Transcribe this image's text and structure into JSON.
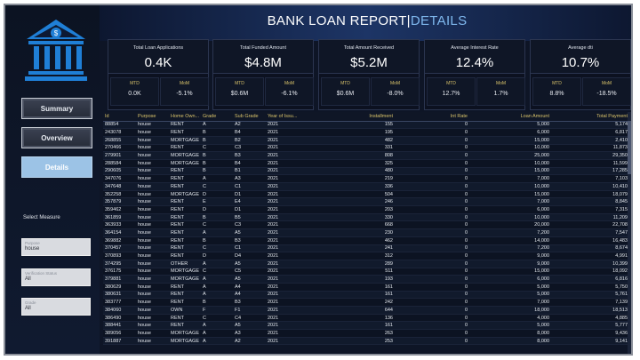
{
  "header": {
    "title_main": "BANK LOAN REPORT",
    "title_sep": "|",
    "title_sub": "DETAILS"
  },
  "sidebar": {
    "nav": [
      {
        "label": "Summary",
        "active": false
      },
      {
        "label": "Overview",
        "active": false
      },
      {
        "label": "Details",
        "active": true
      }
    ],
    "select_measure_label": "Select Measure",
    "slicers": [
      {
        "title": "Purpose",
        "value": "house"
      },
      {
        "title": "Verification Status",
        "value": "All"
      },
      {
        "title": "Grade",
        "value": "All"
      }
    ]
  },
  "kpis": [
    {
      "label": "Total Loan Applications",
      "value": "0.4K",
      "mtd_label": "MTD",
      "mtd": "0.0K",
      "mom_label": "MoM",
      "mom": "-5.1%"
    },
    {
      "label": "Total Funded Amount",
      "value": "$4.8M",
      "mtd_label": "MTD",
      "mtd": "$0.6M",
      "mom_label": "MoM",
      "mom": "-6.1%"
    },
    {
      "label": "Total Amount Received",
      "value": "$5.2M",
      "mtd_label": "MTD",
      "mtd": "$0.6M",
      "mom_label": "MoM",
      "mom": "-8.0%"
    },
    {
      "label": "Average Interest Rate",
      "value": "12.4%",
      "mtd_label": "MTD",
      "mtd": "12.7%",
      "mom_label": "MoM",
      "mom": "1.7%"
    },
    {
      "label": "Average dti",
      "value": "10.7%",
      "mtd_label": "MTD",
      "mtd": "8.8%",
      "mom_label": "MoM",
      "mom": "-18.5%"
    }
  ],
  "table": {
    "columns": [
      "Id",
      "Purpose",
      "Home Own...",
      "Grade",
      "Sub Grade",
      "Year of Issu...",
      "Installment",
      "Int Rate",
      "Loan Amount",
      "Total Payment"
    ],
    "rows": [
      [
        "88854",
        "house",
        "RENT",
        "A",
        "A2",
        "2021",
        "155",
        "0",
        "5,000",
        "5,174"
      ],
      [
        "243078",
        "house",
        "RENT",
        "B",
        "B4",
        "2021",
        "195",
        "0",
        "6,000",
        "6,817"
      ],
      [
        "268855",
        "house",
        "MORTGAGE",
        "B",
        "B2",
        "2021",
        "482",
        "0",
        "15,000",
        "2,410"
      ],
      [
        "270466",
        "house",
        "RENT",
        "C",
        "C3",
        "2021",
        "331",
        "0",
        "10,000",
        "11,873"
      ],
      [
        "279901",
        "house",
        "MORTGAGE",
        "B",
        "B3",
        "2021",
        "808",
        "0",
        "25,000",
        "29,350"
      ],
      [
        "288584",
        "house",
        "MORTGAGE",
        "B",
        "B4",
        "2021",
        "325",
        "0",
        "10,000",
        "11,599"
      ],
      [
        "290605",
        "house",
        "RENT",
        "B",
        "B1",
        "2021",
        "480",
        "0",
        "15,000",
        "17,285"
      ],
      [
        "347076",
        "house",
        "RENT",
        "A",
        "A3",
        "2021",
        "219",
        "0",
        "7,000",
        "7,103"
      ],
      [
        "347648",
        "house",
        "RENT",
        "C",
        "C1",
        "2021",
        "336",
        "0",
        "10,000",
        "10,410"
      ],
      [
        "352258",
        "house",
        "MORTGAGE",
        "D",
        "D1",
        "2021",
        "504",
        "0",
        "15,000",
        "18,079"
      ],
      [
        "357879",
        "house",
        "RENT",
        "E",
        "E4",
        "2021",
        "246",
        "0",
        "7,000",
        "8,845"
      ],
      [
        "359462",
        "house",
        "RENT",
        "D",
        "D1",
        "2021",
        "203",
        "0",
        "6,000",
        "7,315"
      ],
      [
        "361859",
        "house",
        "RENT",
        "B",
        "B5",
        "2021",
        "330",
        "0",
        "10,000",
        "11,209"
      ],
      [
        "363933",
        "house",
        "RENT",
        "C",
        "C3",
        "2021",
        "668",
        "0",
        "20,000",
        "22,708"
      ],
      [
        "364154",
        "house",
        "RENT",
        "A",
        "A5",
        "2021",
        "230",
        "0",
        "7,200",
        "7,547"
      ],
      [
        "369882",
        "house",
        "RENT",
        "B",
        "B3",
        "2021",
        "462",
        "0",
        "14,000",
        "16,483"
      ],
      [
        "370457",
        "house",
        "RENT",
        "C",
        "C1",
        "2021",
        "241",
        "0",
        "7,200",
        "8,674"
      ],
      [
        "370893",
        "house",
        "RENT",
        "D",
        "D4",
        "2021",
        "312",
        "0",
        "9,000",
        "4,991"
      ],
      [
        "374295",
        "house",
        "OTHER",
        "A",
        "A5",
        "2021",
        "289",
        "0",
        "9,000",
        "10,399"
      ],
      [
        "376175",
        "house",
        "MORTGAGE",
        "C",
        "C5",
        "2021",
        "511",
        "0",
        "15,000",
        "18,092"
      ],
      [
        "379881",
        "house",
        "MORTGAGE",
        "A",
        "A5",
        "2021",
        "193",
        "0",
        "6,000",
        "6,816"
      ],
      [
        "380629",
        "house",
        "RENT",
        "A",
        "A4",
        "2021",
        "161",
        "0",
        "5,000",
        "5,750"
      ],
      [
        "380631",
        "house",
        "RENT",
        "A",
        "A4",
        "2021",
        "161",
        "0",
        "5,000",
        "5,761"
      ],
      [
        "383777",
        "house",
        "RENT",
        "B",
        "B3",
        "2021",
        "242",
        "0",
        "7,000",
        "7,139"
      ],
      [
        "384060",
        "house",
        "OWN",
        "F",
        "F1",
        "2021",
        "644",
        "0",
        "18,000",
        "18,513"
      ],
      [
        "386490",
        "house",
        "RENT",
        "C",
        "C4",
        "2021",
        "136",
        "0",
        "4,000",
        "4,885"
      ],
      [
        "388441",
        "house",
        "RENT",
        "A",
        "A5",
        "2021",
        "161",
        "0",
        "5,000",
        "5,777"
      ],
      [
        "389056",
        "house",
        "MORTGAGE",
        "A",
        "A3",
        "2021",
        "263",
        "0",
        "8,000",
        "9,436"
      ],
      [
        "391887",
        "house",
        "MORTGAGE",
        "A",
        "A2",
        "2021",
        "253",
        "0",
        "8,000",
        "9,141"
      ]
    ]
  }
}
